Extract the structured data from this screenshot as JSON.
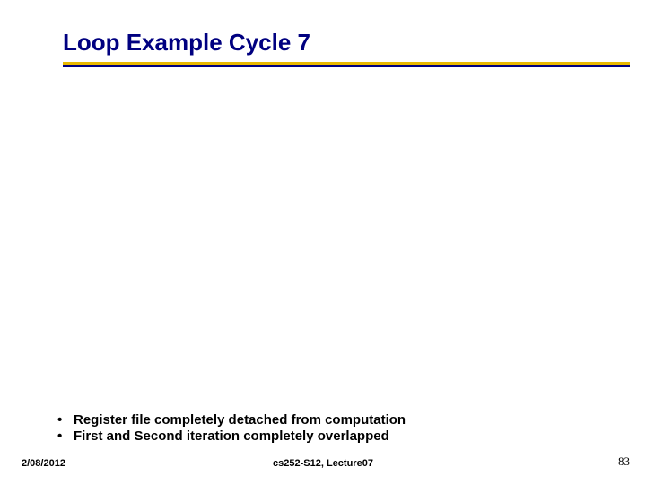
{
  "title": "Loop Example Cycle 7",
  "bullets": {
    "item1": "Register file completely detached from computation",
    "item2": "First and Second iteration completely overlapped"
  },
  "footer": {
    "date": "2/08/2012",
    "center": "cs252-S12, Lecture07",
    "page": "83"
  }
}
